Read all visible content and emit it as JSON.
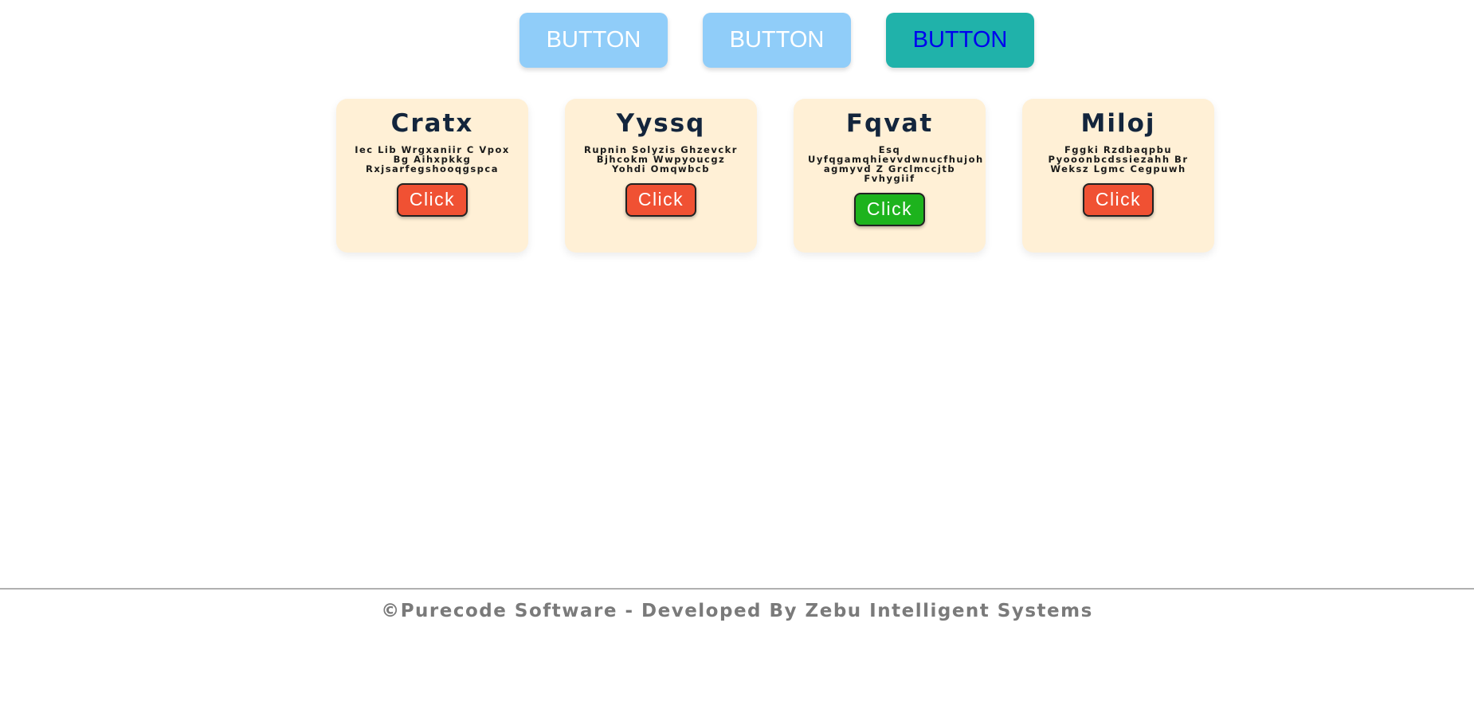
{
  "top_buttons": [
    {
      "label": "BUTTON",
      "state": "inactive"
    },
    {
      "label": "BUTTON",
      "state": "inactive"
    },
    {
      "label": "BUTTON",
      "state": "active"
    }
  ],
  "cards": [
    {
      "title": "Cratx",
      "description": "Iec Lib Wrgxaniir C Vpox Bg Aihxpkkg Rxjsarfegshooqgspca",
      "button_label": "Click",
      "button_color": "#f05133"
    },
    {
      "title": "Yyssq",
      "description": "Rupnin Solyzis Ghzevckr Bjhcokm Wwpyoucgz Yohdi Omqwbcb",
      "button_label": "Click",
      "button_color": "#f05133"
    },
    {
      "title": "Fqvat",
      "description": "Esq Uyfqgamqhievvdwnucfhujoh agmyvd Z Grclmccjtb Fvhygiif",
      "button_label": "Click",
      "button_color": "#1db31d"
    },
    {
      "title": "Miloj",
      "description": "Fggki Rzdbaqpbu Pyooonbcdssiezahh Br Weksz Lgmc Cegpuwh",
      "button_label": "Click",
      "button_color": "#f05133"
    }
  ],
  "footer": {
    "text": "©Purecode Software - Developed By Zebu Intelligent Systems"
  },
  "colors": {
    "top_button_inactive": "#90cdf9",
    "top_button_active": "#20b2aa",
    "card_background": "#fff0d6",
    "card_title": "#13253c"
  }
}
